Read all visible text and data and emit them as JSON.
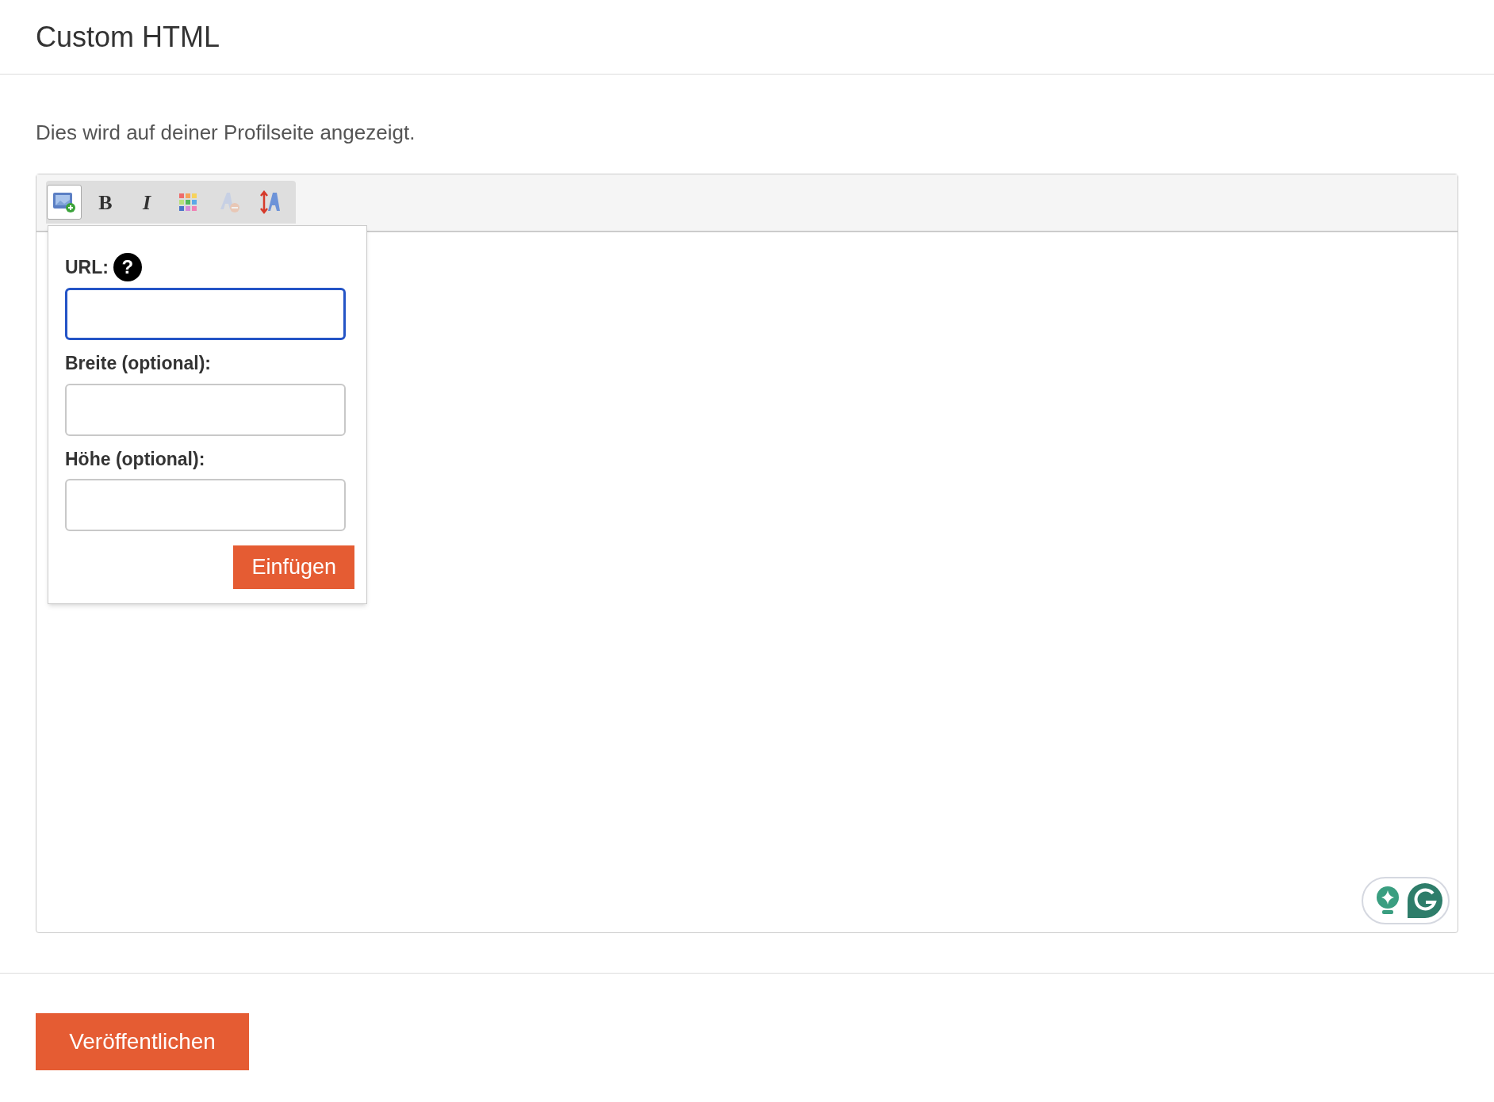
{
  "header": {
    "title": "Custom HTML"
  },
  "description": "Dies wird auf deiner Profilseite angezeigt.",
  "editor": {
    "toolbar": [
      {
        "kind": "image",
        "selected": true
      },
      {
        "kind": "bold",
        "label": "B",
        "selected": false
      },
      {
        "kind": "italic",
        "label": "I",
        "selected": false
      },
      {
        "kind": "colors",
        "selected": false
      },
      {
        "kind": "clear",
        "disabled": true,
        "selected": false
      },
      {
        "kind": "size",
        "selected": false
      }
    ],
    "popup": {
      "fields": [
        {
          "label": "URL:",
          "help": "?",
          "focused": true
        },
        {
          "label": "Breite (optional):",
          "focused": false
        },
        {
          "label": "Höhe (optional):",
          "focused": false
        }
      ],
      "button": "Einfügen"
    }
  },
  "publish_button": "Veröffentlichen"
}
